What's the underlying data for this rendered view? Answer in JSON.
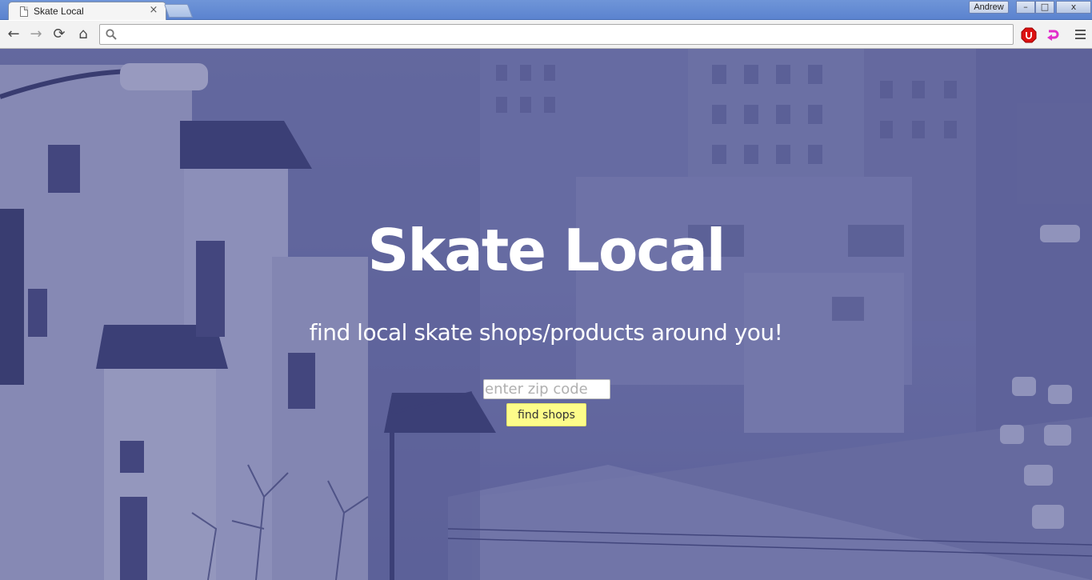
{
  "browser": {
    "tab_title": "Skate Local",
    "tab_close_glyph": "×",
    "profile_name": "Andrew",
    "window_controls": {
      "minimize": "–",
      "maximize": "□",
      "close": "x"
    },
    "nav": {
      "back": "←",
      "forward": "→",
      "reload": "⟳",
      "home": "⌂"
    },
    "omnibox_value": "",
    "extensions": [
      "adblock-icon",
      "pink-arrow-icon"
    ],
    "menu_icon": "hamburger-menu-icon"
  },
  "hero": {
    "title": "Skate Local",
    "subtitle": "find local skate shops/products around you!",
    "zip_placeholder": "enter zip code",
    "zip_value": "",
    "search_button": "find shops"
  },
  "colors": {
    "overlay": "#5b5e8f",
    "button": "#fdfc8a",
    "text": "#ffffff",
    "titlebar": "#6f95d8"
  }
}
